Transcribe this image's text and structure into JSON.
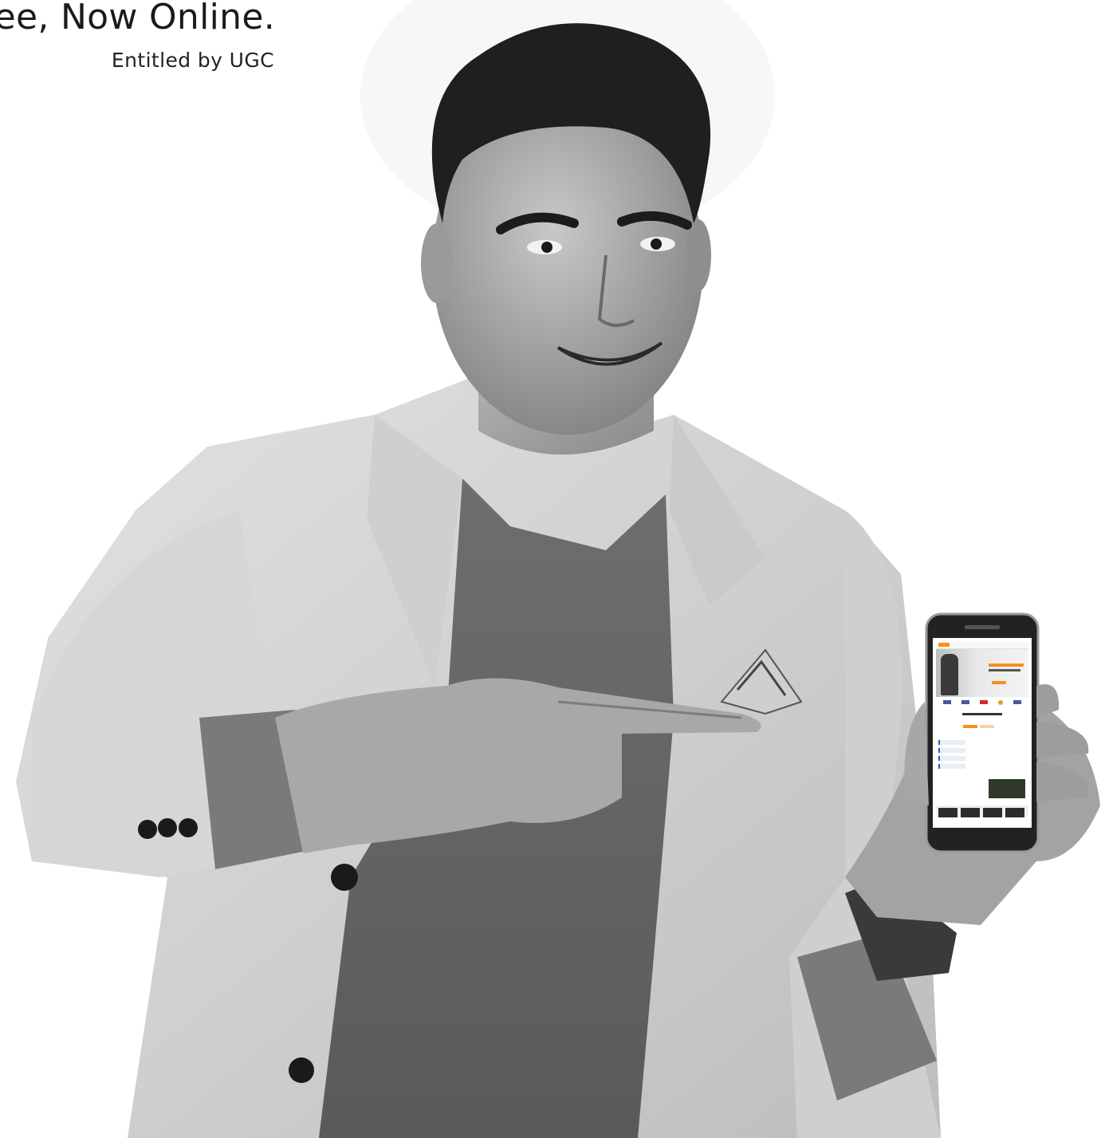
{
  "hero": {
    "headline": "ee, Now Online.",
    "subline": "Entitled by UGC"
  },
  "colors": {
    "background": "#ffffff",
    "text": "#1b1b1b",
    "accent": "#f39221"
  },
  "image": {
    "description_icon": "person-holding-phone-image"
  }
}
